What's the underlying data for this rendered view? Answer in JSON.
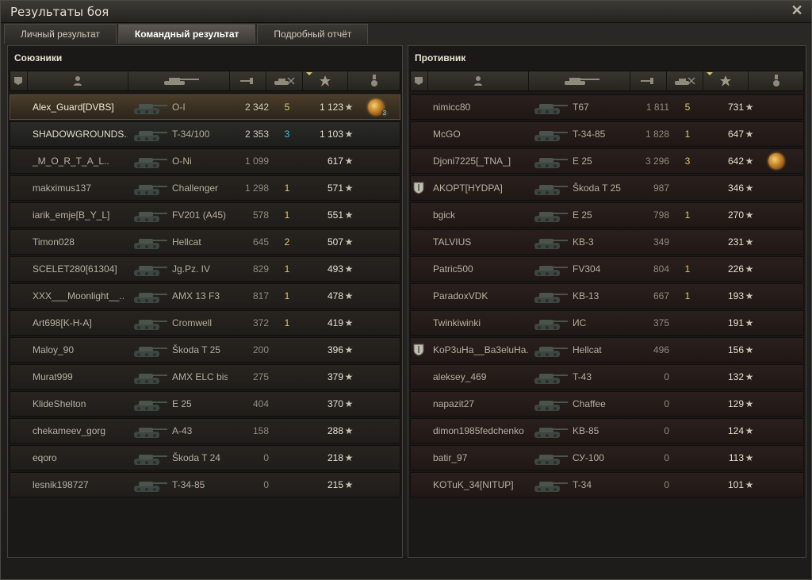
{
  "window": {
    "title": "Результаты боя",
    "close_icon": "close-icon"
  },
  "tabs": [
    {
      "label": "Личный результат",
      "active": false
    },
    {
      "label": "Командный результат",
      "active": true
    },
    {
      "label": "Подробный отчёт",
      "active": false
    }
  ],
  "header_icons": [
    "badge-icon",
    "player-icon",
    "tank-icon",
    "damage-icon",
    "kills-icon",
    "xp-star-icon",
    "medal-icon"
  ],
  "allies": {
    "title": "Союзники",
    "rows": [
      {
        "name": "Alex_Guard[DVBS]",
        "vehicle": "O-I",
        "damage": "2 342",
        "kills": "5",
        "xp": "1 123",
        "medal": true,
        "medal_count": "3",
        "state": "me"
      },
      {
        "name": "SHADOWGROUNDS..",
        "vehicle": "T-34/100",
        "damage": "2 353",
        "kills": "3",
        "xp": "1 103",
        "state": "squad",
        "kills_blue": true
      },
      {
        "name": "_M_O_R_T_A_L..",
        "vehicle": "O-Ni",
        "damage": "1 099",
        "kills": "",
        "xp": "617"
      },
      {
        "name": "makximus137",
        "vehicle": "Challenger",
        "damage": "1 298",
        "kills": "1",
        "xp": "571"
      },
      {
        "name": "iarik_emje[B_Y_L]",
        "vehicle": "FV201 (A45)",
        "damage": "578",
        "kills": "1",
        "xp": "551"
      },
      {
        "name": "Timon028",
        "vehicle": "Hellcat",
        "damage": "645",
        "kills": "2",
        "xp": "507"
      },
      {
        "name": "SCELET280[61304]",
        "vehicle": "Jg.Pz. IV",
        "damage": "829",
        "kills": "1",
        "xp": "493"
      },
      {
        "name": "XXX___Moonlight__..",
        "vehicle": "AMX 13 F3",
        "damage": "817",
        "kills": "1",
        "xp": "478"
      },
      {
        "name": "Art698[K-H-A]",
        "vehicle": "Cromwell",
        "damage": "372",
        "kills": "1",
        "xp": "419"
      },
      {
        "name": "Maloy_90",
        "vehicle": "Škoda T 25",
        "damage": "200",
        "kills": "",
        "xp": "396"
      },
      {
        "name": "Murat999",
        "vehicle": "AMX ELC bis",
        "damage": "275",
        "kills": "",
        "xp": "379"
      },
      {
        "name": "KlideShelton",
        "vehicle": "E 25",
        "damage": "404",
        "kills": "",
        "xp": "370"
      },
      {
        "name": "chekameev_gorg",
        "vehicle": "A-43",
        "damage": "158",
        "kills": "",
        "xp": "288"
      },
      {
        "name": "eqoro",
        "vehicle": "Škoda T 24",
        "damage": "0",
        "kills": "",
        "xp": "218"
      },
      {
        "name": "lesnik198727",
        "vehicle": "T-34-85",
        "damage": "0",
        "kills": "",
        "xp": "215"
      }
    ]
  },
  "enemies": {
    "title": "Противник",
    "rows": [
      {
        "name": "nimicc80",
        "vehicle": "T67",
        "damage": "1 811",
        "kills": "5",
        "xp": "731"
      },
      {
        "name": "McGO",
        "vehicle": "T-34-85",
        "damage": "1 828",
        "kills": "1",
        "xp": "647"
      },
      {
        "name": "Djoni7225[_TNA_]",
        "vehicle": "E 25",
        "damage": "3 296",
        "kills": "3",
        "xp": "642",
        "medal": true
      },
      {
        "name": "AKOPT[HYDPA]",
        "vehicle": "Škoda T 25",
        "damage": "987",
        "kills": "",
        "xp": "346",
        "badge": true
      },
      {
        "name": "bgick",
        "vehicle": "E 25",
        "damage": "798",
        "kills": "1",
        "xp": "270"
      },
      {
        "name": "TALVIUS",
        "vehicle": "KB-3",
        "damage": "349",
        "kills": "",
        "xp": "231"
      },
      {
        "name": "Patric500",
        "vehicle": "FV304",
        "damage": "804",
        "kills": "1",
        "xp": "226"
      },
      {
        "name": "ParadoxVDK",
        "vehicle": "KB-13",
        "damage": "667",
        "kills": "1",
        "xp": "193"
      },
      {
        "name": "Twinkiwinki",
        "vehicle": "ИС",
        "damage": "375",
        "kills": "",
        "xp": "191"
      },
      {
        "name": "KoP3uHa__Ba3eluHa..",
        "vehicle": "Hellcat",
        "damage": "496",
        "kills": "",
        "xp": "156",
        "badge": true
      },
      {
        "name": "aleksey_469",
        "vehicle": "T-43",
        "damage": "0",
        "kills": "",
        "xp": "132"
      },
      {
        "name": "napazit27",
        "vehicle": "Chaffee",
        "damage": "0",
        "kills": "",
        "xp": "129"
      },
      {
        "name": "dimon1985fedchenko",
        "vehicle": "KB-85",
        "damage": "0",
        "kills": "",
        "xp": "124"
      },
      {
        "name": "batir_97",
        "vehicle": "СУ-100",
        "damage": "0",
        "kills": "",
        "xp": "113"
      },
      {
        "name": "KOTuK_34[NITUP]",
        "vehicle": "T-34",
        "damage": "0",
        "kills": "",
        "xp": "101"
      }
    ]
  }
}
